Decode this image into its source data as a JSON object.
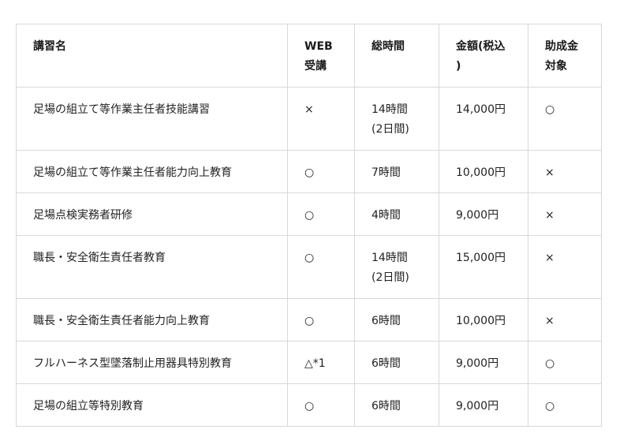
{
  "table": {
    "headers": {
      "course": "講習名",
      "web": "WEB\n受講",
      "hours": "総時間",
      "price": "金額(税込\n)",
      "subsidy": "助成金\n対象"
    },
    "rows": [
      {
        "course": "足場の組立て等作業主任者技能講習",
        "web": "×",
        "hours": "14時間\n(2日間)",
        "price": "14,000円",
        "subsidy": "○"
      },
      {
        "course": "足場の組立て等作業主任者能力向上教育",
        "web": "○",
        "hours": "7時間",
        "price": "10,000円",
        "subsidy": "×"
      },
      {
        "course": "足場点検実務者研修",
        "web": "○",
        "hours": "4時間",
        "price": "9,000円",
        "subsidy": "×"
      },
      {
        "course": "職長・安全衛生責任者教育",
        "web": "○",
        "hours": "14時間\n(2日間)",
        "price": "15,000円",
        "subsidy": "×"
      },
      {
        "course": "職長・安全衛生責任者能力向上教育",
        "web": "○",
        "hours": "6時間",
        "price": "10,000円",
        "subsidy": "×"
      },
      {
        "course": "フルハーネス型墜落制止用器具特別教育",
        "web": "△*1",
        "hours": "6時間",
        "price": "9,000円",
        "subsidy": "○"
      },
      {
        "course": "足場の組立等特別教育",
        "web": "○",
        "hours": "6時間",
        "price": "9,000円",
        "subsidy": "○"
      }
    ]
  }
}
